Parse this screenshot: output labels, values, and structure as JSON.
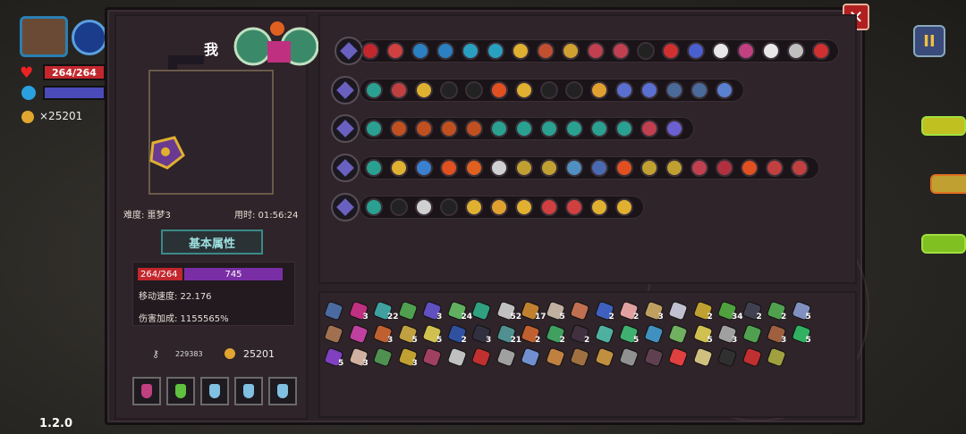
{
  "hud": {
    "hp_text": "264/264",
    "coins": "×25201",
    "version": "1.2.0",
    "pause_label": "II"
  },
  "panel": {
    "close_label": "✕",
    "player_name": "我",
    "difficulty": "难度: 噩梦3",
    "time_used": "用时: 01:56:24",
    "attributes_button": "基本属性",
    "hp_mini": "264/264",
    "shield_mini": "745",
    "move_speed": "移动速度: 22.176",
    "damage_bonus": "伤害加成: 1155565%",
    "key_count": "229383",
    "coin_count": "25201"
  },
  "colors": {
    "panel_bg": "#2b2228",
    "hp_red": "#c2272d",
    "shield_purple": "#7a2ea6",
    "teal_button": "#3a8a8a",
    "close_red": "#b02020"
  },
  "equipment_rows": [
    {
      "lead_icon": "chest-icon",
      "slots": [
        "#c2272d",
        "#d04040",
        "#2a80c0",
        "#2a80c0",
        "#2aa0c0",
        "#2aa0c0",
        "#e0b030",
        "#c05030",
        "#d0a030",
        "#c04050",
        "#c04050",
        "#222",
        "#d03030",
        "#4a60d0",
        "#e8e8e8",
        "#c04080",
        "#e8e8e8",
        "#c0c0c0",
        "#d03030",
        "#222"
      ]
    },
    {
      "lead_icon": "scepter-icon",
      "slots": [
        "#2aa090",
        "#c04040",
        "#e0b030",
        "#222",
        "#222",
        "#e05020",
        "#e0b030",
        "#222",
        "#222",
        "#e0a030",
        "#5a70d0",
        "#5a70d0",
        "#4a6a9a",
        "#4a6a9a",
        "#5a80d0"
      ]
    },
    {
      "lead_icon": "staff-icon",
      "slots": [
        "#2aa090",
        "#c05020",
        "#c05020",
        "#c05020",
        "#c05020",
        "#2aa090",
        "#2aa090",
        "#2aa090",
        "#2aa090",
        "#2aa090",
        "#2aa090",
        "#c04050",
        "#6a60d0"
      ]
    },
    {
      "lead_icon": "trident-icon",
      "slots": [
        "#2aa090",
        "#e0b030",
        "#3a80d0",
        "#e05020",
        "#e06020",
        "#d0d0d0",
        "#c0a030",
        "#c0a030",
        "#5090c0",
        "#4a6ab0",
        "#e05020",
        "#c0a030",
        "#c0a030",
        "#c04050",
        "#b03040",
        "#e05020",
        "#c04040",
        "#c04040"
      ]
    },
    {
      "lead_icon": "wand-icon",
      "slots": [
        "#2aa090",
        "#222",
        "#d0d0d0",
        "#222",
        "#e0b030",
        "#e0a030",
        "#e0b030",
        "#d04040",
        "#d04040",
        "#e0b030",
        "#e0b030"
      ]
    }
  ],
  "inventory": [
    {
      "color": "#4a6aa0",
      "count": ""
    },
    {
      "color": "#c03080",
      "count": "3"
    },
    {
      "color": "#40a0a0",
      "count": "22"
    },
    {
      "color": "#50a050",
      "count": ""
    },
    {
      "color": "#6050c0",
      "count": "3"
    },
    {
      "color": "#60b060",
      "count": "24"
    },
    {
      "color": "#30a080",
      "count": ""
    },
    {
      "color": "#c0c0c0",
      "count": "52"
    },
    {
      "color": "#c08030",
      "count": "17"
    },
    {
      "color": "#c0b0a0",
      "count": "5"
    },
    {
      "color": "#c07050",
      "count": ""
    },
    {
      "color": "#4060c0",
      "count": "2"
    },
    {
      "color": "#e0a0a0",
      "count": "2"
    },
    {
      "color": "#c0a060",
      "count": "3"
    },
    {
      "color": "#c0c0d0",
      "count": ""
    },
    {
      "color": "#c0a030",
      "count": "2"
    },
    {
      "color": "#50a040",
      "count": "34"
    },
    {
      "color": "#404050",
      "count": "2"
    },
    {
      "color": "#50a050",
      "count": "2"
    },
    {
      "color": "#8090c0",
      "count": "5"
    },
    {
      "color": "#a07050",
      "count": ""
    },
    {
      "color": "#c040a0",
      "count": ""
    },
    {
      "color": "#c06030",
      "count": "3"
    },
    {
      "color": "#c0a040",
      "count": "5"
    },
    {
      "color": "#d0c050",
      "count": "5"
    },
    {
      "color": "#3050a0",
      "count": "2"
    },
    {
      "color": "#303040",
      "count": "3"
    },
    {
      "color": "#509090",
      "count": "21"
    },
    {
      "color": "#c06030",
      "count": "2"
    },
    {
      "color": "#40a060",
      "count": "2"
    },
    {
      "color": "#403040",
      "count": "2"
    },
    {
      "color": "#50b0a0",
      "count": ""
    },
    {
      "color": "#40b070",
      "count": "5"
    },
    {
      "color": "#4090c0",
      "count": ""
    },
    {
      "color": "#70b060",
      "count": ""
    },
    {
      "color": "#d0c050",
      "count": "5"
    },
    {
      "color": "#a0a0a0",
      "count": "3"
    },
    {
      "color": "#50a050",
      "count": ""
    },
    {
      "color": "#a06040",
      "count": "3"
    },
    {
      "color": "#30b060",
      "count": "5"
    },
    {
      "color": "#8040c0",
      "count": "5"
    },
    {
      "color": "#d0b0a0",
      "count": "3"
    },
    {
      "color": "#509050",
      "count": ""
    },
    {
      "color": "#c0a030",
      "count": "3"
    },
    {
      "color": "#a04060",
      "count": ""
    },
    {
      "color": "#c0c0c0",
      "count": ""
    },
    {
      "color": "#c03030",
      "count": ""
    },
    {
      "color": "#a0a0a0",
      "count": ""
    },
    {
      "color": "#7090d0",
      "count": ""
    },
    {
      "color": "#c08040",
      "count": ""
    },
    {
      "color": "#a07040",
      "count": ""
    },
    {
      "color": "#c09040",
      "count": ""
    },
    {
      "color": "#909090",
      "count": ""
    },
    {
      "color": "#604050",
      "count": ""
    },
    {
      "color": "#e04040",
      "count": ""
    },
    {
      "color": "#d0c080",
      "count": ""
    },
    {
      "color": "#303030",
      "count": ""
    },
    {
      "color": "#c03030",
      "count": ""
    },
    {
      "color": "#a0a040",
      "count": ""
    }
  ],
  "potions": [
    "#c04080",
    "#60c040",
    "#80c0e0",
    "#80c0e0",
    "#80c0e0"
  ]
}
